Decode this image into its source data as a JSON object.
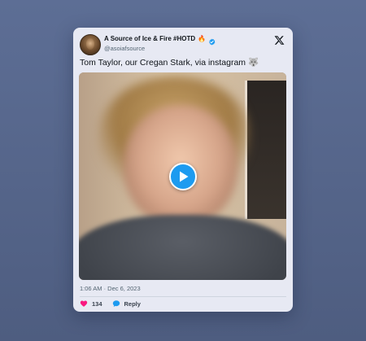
{
  "tweet": {
    "display_name": "A Source of Ice & Fire #HOTD",
    "name_emoji": "🔥",
    "verified": true,
    "handle": "@asoiafsource",
    "text": "Tom Taylor, our Cregan Stark, via instagram 🐺",
    "media": {
      "type": "video",
      "play_icon": "play-icon"
    },
    "timestamp": "1:06 AM · Dec 6, 2023",
    "likes": "134",
    "reply_label": "Reply"
  },
  "icons": {
    "verified": "verified-badge-icon",
    "platform": "x-logo-icon",
    "like": "heart-icon",
    "reply": "reply-bubble-icon"
  },
  "colors": {
    "accent": "#1d9bf0",
    "like": "#f91880",
    "background": "#56668b",
    "card": "#e7e9f3"
  }
}
